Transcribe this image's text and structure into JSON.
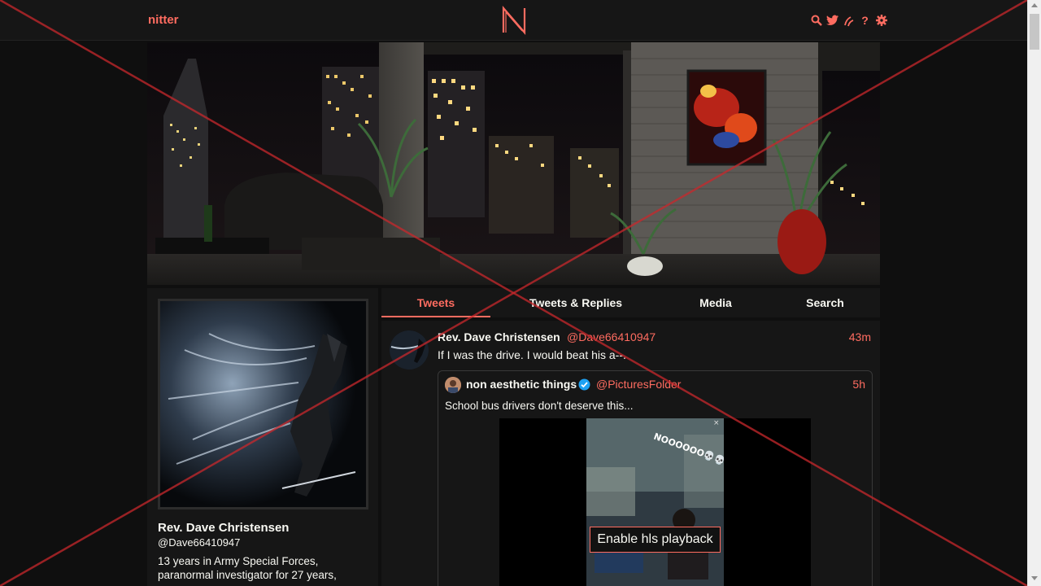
{
  "nav": {
    "site_name": "nitter",
    "logo_letter": "N",
    "icons": [
      "search-icon",
      "twitter-icon",
      "rss-icon",
      "help-icon",
      "settings-icon"
    ]
  },
  "colors": {
    "accent": "#ff6c60",
    "background": "#0f0f0f",
    "panel": "#161616",
    "text": "#f8f8f2"
  },
  "profile": {
    "fullname": "Rev. Dave Christensen",
    "username": "@Dave66410947",
    "bio": "13 years in Army Special Forces, paranormal investigator for 27 years,"
  },
  "tabs": [
    {
      "label": "Tweets",
      "active": true
    },
    {
      "label": "Tweets & Replies",
      "active": false
    },
    {
      "label": "Media",
      "active": false
    },
    {
      "label": "Search",
      "active": false
    }
  ],
  "tweet": {
    "fullname": "Rev. Dave Christensen",
    "username": "@Dave66410947",
    "time": "43m",
    "text": "If I was the drive. I would  beat his a--.",
    "quote": {
      "fullname": "non aesthetic things",
      "verified": true,
      "username": "@PicturesFolder",
      "time": "5h",
      "text": "School bus drivers don't deserve this...",
      "video_overlay_text": "NOOOOOO💀💀💀",
      "hls_button": "Enable hls playback"
    }
  }
}
